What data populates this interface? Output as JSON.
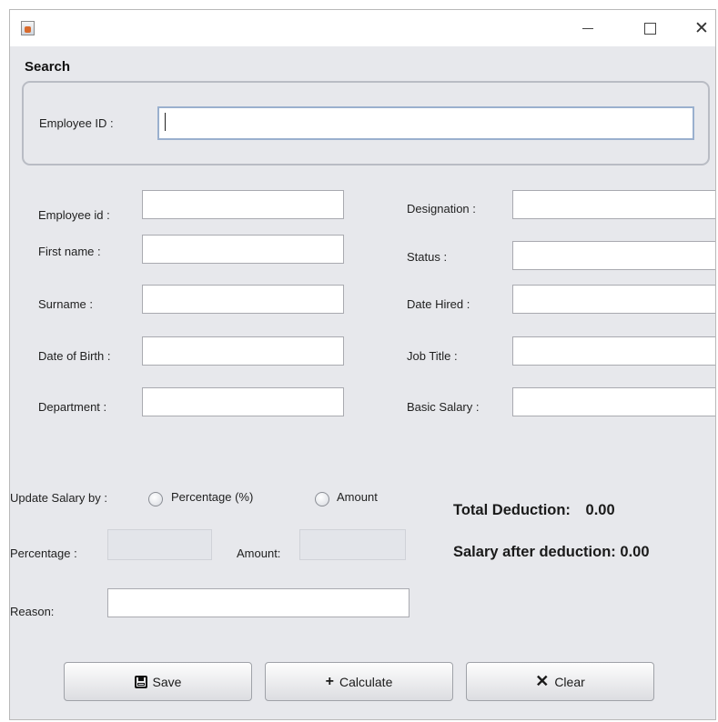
{
  "window": {
    "title": "",
    "controls": [
      "minimize",
      "maximize",
      "close"
    ]
  },
  "search": {
    "title": "Search",
    "employee_id_label": "Employee ID :",
    "employee_id_value": ""
  },
  "form": {
    "left": [
      {
        "label": "Employee id :",
        "value": ""
      },
      {
        "label": "First name :",
        "value": ""
      },
      {
        "label": "Surname :",
        "value": ""
      },
      {
        "label": "Date of Birth :",
        "value": ""
      },
      {
        "label": "Department :",
        "value": ""
      }
    ],
    "right": [
      {
        "label": "Designation :",
        "value": ""
      },
      {
        "label": "Status :",
        "value": ""
      },
      {
        "label": "Date Hired :",
        "value": ""
      },
      {
        "label": "Job Title :",
        "value": ""
      },
      {
        "label": "Basic Salary :",
        "value": ""
      }
    ]
  },
  "update": {
    "label": "Update Salary by :",
    "options": [
      {
        "label": "Percentage (%)",
        "selected": false
      },
      {
        "label": "Amount",
        "selected": false
      }
    ],
    "percentage_label": "Percentage :",
    "percentage_value": "",
    "amount_label": "Amount:",
    "amount_value": "",
    "reason_label": "Reason:",
    "reason_value": ""
  },
  "summary": {
    "total_deduction_label": "Total Deduction:",
    "total_deduction_value": "0.00",
    "salary_after_label": "Salary after deduction:",
    "salary_after_value": "0.00"
  },
  "buttons": {
    "save": {
      "label": "Save",
      "icon": "save-icon"
    },
    "calculate": {
      "label": "Calculate",
      "icon": "plus-icon"
    },
    "clear": {
      "label": "Clear",
      "icon": "x-icon"
    }
  }
}
